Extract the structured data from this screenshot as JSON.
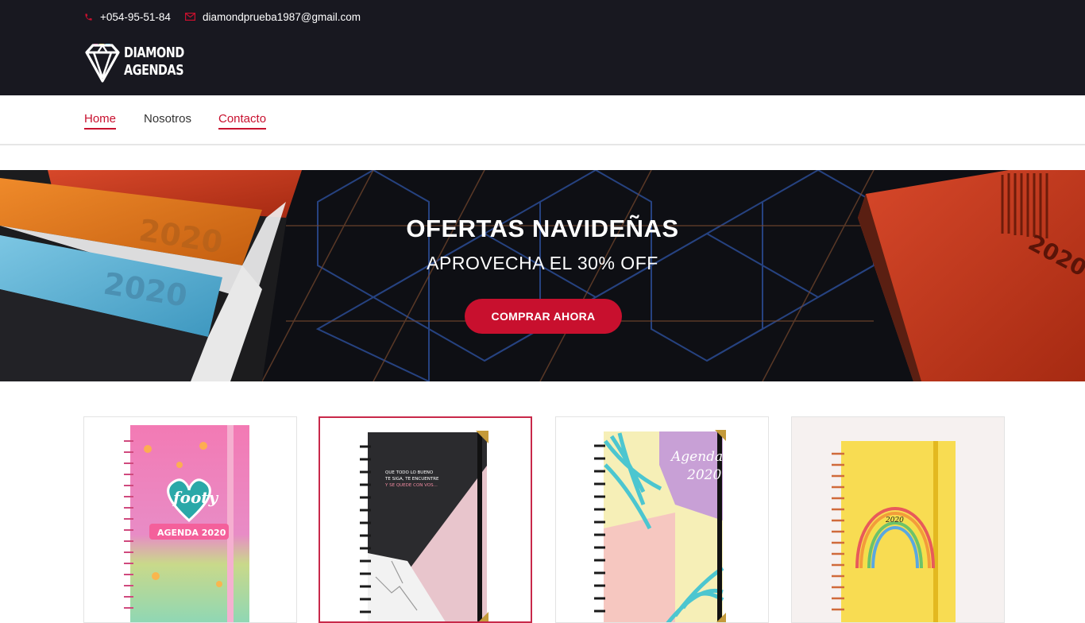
{
  "header": {
    "phone": "+054-95-51-84",
    "email": "diamondprueba1987@gmail.com",
    "logo": {
      "line1": "DIAMOND",
      "line2": "AGENDAS"
    }
  },
  "nav": {
    "items": [
      {
        "label": "Home",
        "state": "active"
      },
      {
        "label": "Nosotros",
        "state": "normal"
      },
      {
        "label": "Contacto",
        "state": "active"
      }
    ]
  },
  "hero": {
    "title": "OFERTAS NAVIDEÑAS",
    "subtitle": "APROVECHA EL 30% OFF",
    "button": "COMPRAR AHORA",
    "book_year": "2020"
  },
  "products": [
    {
      "name": "footy",
      "cover_text": "AGENDA 2020"
    },
    {
      "cover_text": "QUE TODO LO BUENO TE SIGA, TE ENCUENTRE Y SE QUEDE CON VOS..."
    },
    {
      "cover_text": "Agenda 2020"
    },
    {
      "cover_text": "2020"
    }
  ],
  "colors": {
    "accent": "#c8102e",
    "topbar": "#181820",
    "nav_text": "#333333"
  }
}
